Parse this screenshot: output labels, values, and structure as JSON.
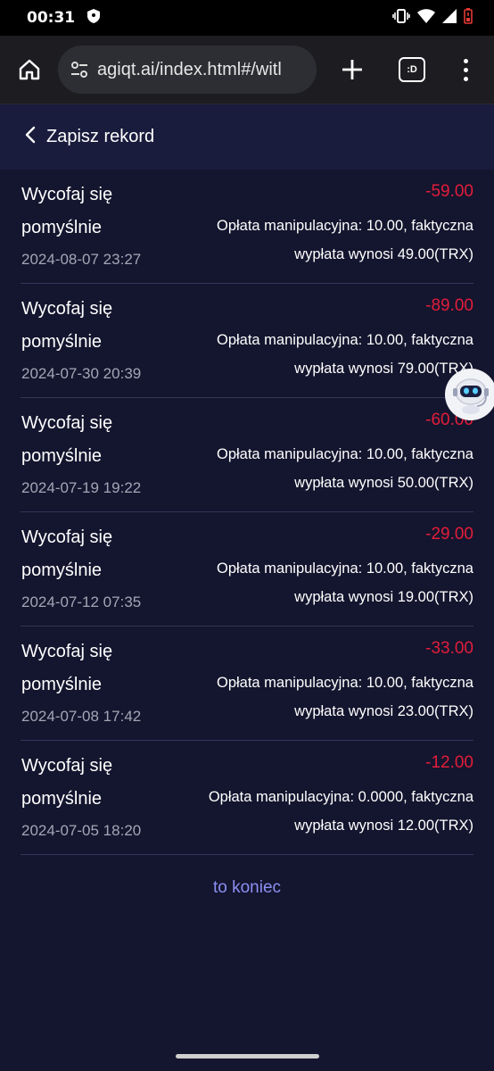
{
  "status_bar": {
    "time": "00:31",
    "icons": [
      "shield-icon",
      "vibrate-icon",
      "wifi-icon",
      "signal-icon",
      "battery-low-icon"
    ]
  },
  "browser": {
    "url": "agiqt.ai/index.html#/witl",
    "tabs_label": ":D",
    "icons": [
      "home-icon",
      "site-settings-icon",
      "new-tab-icon",
      "tabs-icon",
      "more-menu-icon"
    ]
  },
  "header": {
    "title": "Zapisz rekord",
    "icon": "chevron-left-icon"
  },
  "records": [
    {
      "status": "Wycofaj się pomyślnie",
      "date": "2024-08-07 23:27",
      "amount": "-59.00",
      "note": "Opłata manipulacyjna: 10.00, faktyczna wypłata wynosi 49.00(TRX)"
    },
    {
      "status": "Wycofaj się pomyślnie",
      "date": "2024-07-30 20:39",
      "amount": "-89.00",
      "note": "Opłata manipulacyjna: 10.00, faktyczna wypłata wynosi 79.00(TRX)"
    },
    {
      "status": "Wycofaj się pomyślnie",
      "date": "2024-07-19 19:22",
      "amount": "-60.00",
      "note": "Opłata manipulacyjna: 10.00, faktyczna wypłata wynosi 50.00(TRX)"
    },
    {
      "status": "Wycofaj się pomyślnie",
      "date": "2024-07-12 07:35",
      "amount": "-29.00",
      "note": "Opłata manipulacyjna: 10.00, faktyczna wypłata wynosi 19.00(TRX)"
    },
    {
      "status": "Wycofaj się pomyślnie",
      "date": "2024-07-08 17:42",
      "amount": "-33.00",
      "note": "Opłata manipulacyjna: 10.00, faktyczna wypłata wynosi 23.00(TRX)"
    },
    {
      "status": "Wycofaj się pomyślnie",
      "date": "2024-07-05 18:20",
      "amount": "-12.00",
      "note": "Opłata manipulacyjna: 0.0000, faktyczna wypłata wynosi 12.00(TRX)"
    }
  ],
  "footer": {
    "end_text": "to koniec"
  },
  "colors": {
    "background": "#14152e",
    "header_bg": "#1a1c3d",
    "amount": "#e21d3a",
    "end_text": "#8c8ff2"
  },
  "floating": {
    "icon": "robot-assistant-icon"
  }
}
